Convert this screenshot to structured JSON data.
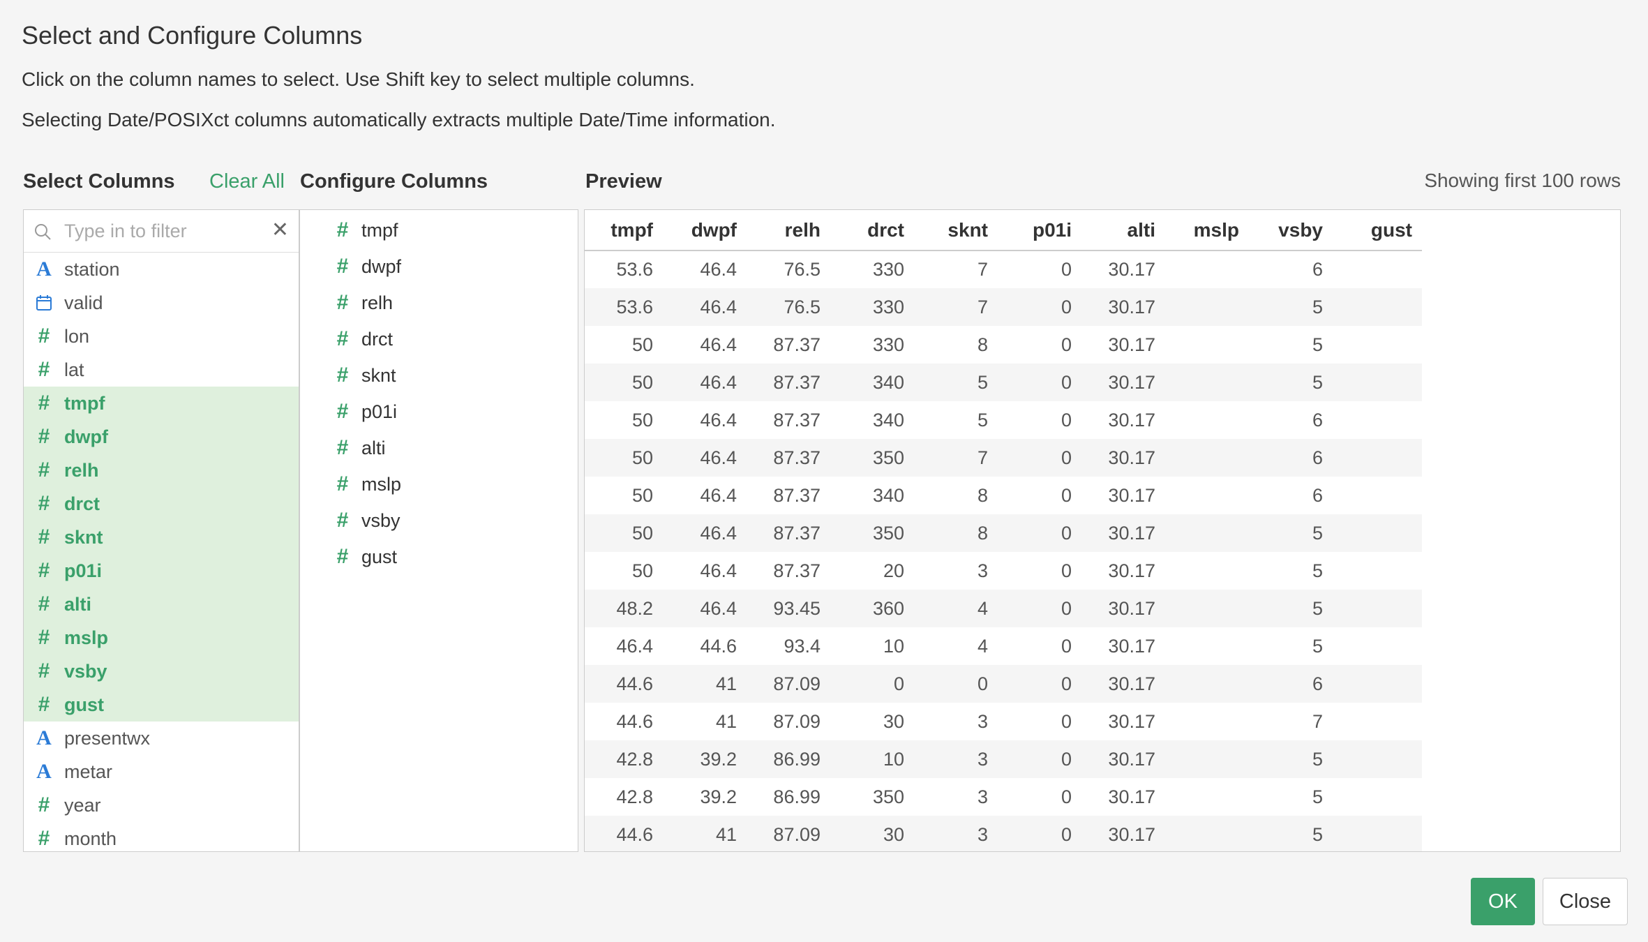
{
  "dialog": {
    "title": "Select and Configure Columns",
    "desc1": "Click on the column names to select. Use Shift key to select multiple columns.",
    "desc2": "Selecting Date/POSIXct columns automatically extracts multiple Date/Time information."
  },
  "select_columns": {
    "label": "Select Columns",
    "clear_all": "Clear All",
    "filter_placeholder": "Type in to filter",
    "items": [
      {
        "name": "station",
        "type": "string",
        "selected": false
      },
      {
        "name": "valid",
        "type": "date",
        "selected": false
      },
      {
        "name": "lon",
        "type": "number",
        "selected": false
      },
      {
        "name": "lat",
        "type": "number",
        "selected": false
      },
      {
        "name": "tmpf",
        "type": "number",
        "selected": true
      },
      {
        "name": "dwpf",
        "type": "number",
        "selected": true
      },
      {
        "name": "relh",
        "type": "number",
        "selected": true
      },
      {
        "name": "drct",
        "type": "number",
        "selected": true
      },
      {
        "name": "sknt",
        "type": "number",
        "selected": true
      },
      {
        "name": "p01i",
        "type": "number",
        "selected": true
      },
      {
        "name": "alti",
        "type": "number",
        "selected": true
      },
      {
        "name": "mslp",
        "type": "number",
        "selected": true
      },
      {
        "name": "vsby",
        "type": "number",
        "selected": true
      },
      {
        "name": "gust",
        "type": "number",
        "selected": true
      },
      {
        "name": "presentwx",
        "type": "string",
        "selected": false
      },
      {
        "name": "metar",
        "type": "string",
        "selected": false
      },
      {
        "name": "year",
        "type": "number",
        "selected": false
      },
      {
        "name": "month",
        "type": "number",
        "selected": false
      }
    ]
  },
  "configure_columns": {
    "label": "Configure Columns",
    "items": [
      "tmpf",
      "dwpf",
      "relh",
      "drct",
      "sknt",
      "p01i",
      "alti",
      "mslp",
      "vsby",
      "gust"
    ]
  },
  "preview": {
    "label": "Preview",
    "showing": "Showing first 100 rows",
    "columns": [
      "tmpf",
      "dwpf",
      "relh",
      "drct",
      "sknt",
      "p01i",
      "alti",
      "mslp",
      "vsby",
      "gust"
    ],
    "rows": [
      [
        "53.6",
        "46.4",
        "76.5",
        "330",
        "7",
        "0",
        "30.17",
        "",
        "6",
        ""
      ],
      [
        "53.6",
        "46.4",
        "76.5",
        "330",
        "7",
        "0",
        "30.17",
        "",
        "5",
        ""
      ],
      [
        "50",
        "46.4",
        "87.37",
        "330",
        "8",
        "0",
        "30.17",
        "",
        "5",
        ""
      ],
      [
        "50",
        "46.4",
        "87.37",
        "340",
        "5",
        "0",
        "30.17",
        "",
        "5",
        ""
      ],
      [
        "50",
        "46.4",
        "87.37",
        "340",
        "5",
        "0",
        "30.17",
        "",
        "6",
        ""
      ],
      [
        "50",
        "46.4",
        "87.37",
        "350",
        "7",
        "0",
        "30.17",
        "",
        "6",
        ""
      ],
      [
        "50",
        "46.4",
        "87.37",
        "340",
        "8",
        "0",
        "30.17",
        "",
        "6",
        ""
      ],
      [
        "50",
        "46.4",
        "87.37",
        "350",
        "8",
        "0",
        "30.17",
        "",
        "5",
        ""
      ],
      [
        "50",
        "46.4",
        "87.37",
        "20",
        "3",
        "0",
        "30.17",
        "",
        "5",
        ""
      ],
      [
        "48.2",
        "46.4",
        "93.45",
        "360",
        "4",
        "0",
        "30.17",
        "",
        "5",
        ""
      ],
      [
        "46.4",
        "44.6",
        "93.4",
        "10",
        "4",
        "0",
        "30.17",
        "",
        "5",
        ""
      ],
      [
        "44.6",
        "41",
        "87.09",
        "0",
        "0",
        "0",
        "30.17",
        "",
        "6",
        ""
      ],
      [
        "44.6",
        "41",
        "87.09",
        "30",
        "3",
        "0",
        "30.17",
        "",
        "7",
        ""
      ],
      [
        "42.8",
        "39.2",
        "86.99",
        "10",
        "3",
        "0",
        "30.17",
        "",
        "5",
        ""
      ],
      [
        "42.8",
        "39.2",
        "86.99",
        "350",
        "3",
        "0",
        "30.17",
        "",
        "5",
        ""
      ],
      [
        "44.6",
        "41",
        "87.09",
        "30",
        "3",
        "0",
        "30.17",
        "",
        "5",
        ""
      ]
    ]
  },
  "buttons": {
    "ok": "OK",
    "close": "Close"
  },
  "colors": {
    "accent_green": "#3aa06a",
    "selected_bg": "#dff0dd",
    "string_icon_blue": "#2b7bd6"
  }
}
